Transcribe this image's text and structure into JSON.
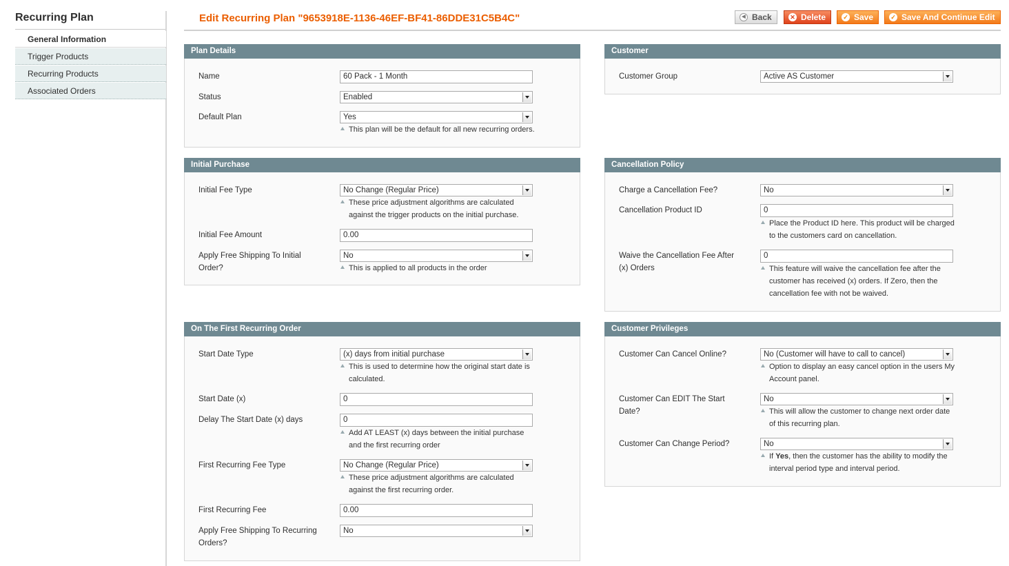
{
  "sidebar": {
    "title": "Recurring Plan",
    "tabs": [
      "General Information",
      "Trigger Products",
      "Recurring Products",
      "Associated Orders"
    ]
  },
  "header": {
    "title": "Edit Recurring Plan \"9653918E-1136-46EF-BF41-86DDE31C5B4C\"",
    "buttons": {
      "back": "Back",
      "delete": "Delete",
      "save": "Save",
      "save_continue": "Save And Continue Edit"
    }
  },
  "plan_details": {
    "heading": "Plan Details",
    "name_label": "Name",
    "name_value": "60 Pack - 1 Month",
    "status_label": "Status",
    "status_value": "Enabled",
    "default_label": "Default Plan",
    "default_value": "Yes",
    "default_note": "This plan will be the default for all new recurring orders."
  },
  "customer": {
    "heading": "Customer",
    "group_label": "Customer Group",
    "group_value": "Active AS Customer"
  },
  "initial_purchase": {
    "heading": "Initial Purchase",
    "fee_type_label": "Initial Fee Type",
    "fee_type_value": "No Change (Regular Price)",
    "fee_type_note_1": "These price adjustment algorithms are calculated",
    "fee_type_note_2": "against the trigger products on the initial purchase.",
    "fee_amount_label": "Initial Fee Amount",
    "fee_amount_value": "0.00",
    "shipping_label_1": "Apply Free Shipping To Initial",
    "shipping_label_2": "Order?",
    "shipping_value": "No",
    "shipping_note": "This is applied to all products in the order"
  },
  "cancellation": {
    "heading": "Cancellation Policy",
    "charge_label": "Charge a Cancellation Fee?",
    "charge_value": "No",
    "product_label": "Cancellation Product ID",
    "product_value": "0",
    "product_note_1": "Place the Product ID here. This product will be charged",
    "product_note_2": "to the customers card on cancellation.",
    "waive_label_1": "Waive the Cancellation Fee After",
    "waive_label_2": "(x) Orders",
    "waive_value": "0",
    "waive_note_1": "This feature will waive the cancellation fee after the",
    "waive_note_2": "customer has received (x) orders. If Zero, then the",
    "waive_note_3": "cancellation fee with not be waived."
  },
  "first_recurring": {
    "heading": "On The First Recurring Order",
    "start_type_label": "Start Date Type",
    "start_type_value": "(x) days from initial purchase",
    "start_type_note_1": "This is used to determine how the original start date is",
    "start_type_note_2": "calculated.",
    "start_date_label": "Start Date (x)",
    "start_date_value": "0",
    "delay_label": "Delay The Start Date (x) days",
    "delay_value": "0",
    "delay_note_1": "Add AT LEAST (x) days between the initial purchase",
    "delay_note_2": "and the first recurring order",
    "fee_type_label": "First Recurring Fee Type",
    "fee_type_value": "No Change (Regular Price)",
    "fee_type_note_1": "These price adjustment algorithms are calculated",
    "fee_type_note_2": "against the first recurring order.",
    "fee_label": "First Recurring Fee",
    "fee_value": "0.00",
    "shipping_label_1": "Apply Free Shipping To Recurring",
    "shipping_label_2": "Orders?",
    "shipping_value": "No"
  },
  "privileges": {
    "heading": "Customer Privileges",
    "cancel_label": "Customer Can Cancel Online?",
    "cancel_value": "No (Customer will have to call to cancel)",
    "cancel_note_1": "Option to display an easy cancel option in the users My",
    "cancel_note_2": "Account panel.",
    "edit_label_1": "Customer Can EDIT The Start",
    "edit_label_2": "Date?",
    "edit_value": "No",
    "edit_note_1": "This will allow the customer to change next order date",
    "edit_note_2": "of this recurring plan.",
    "period_label": "Customer Can Change Period?",
    "period_value": "No",
    "period_note_if": "If",
    "period_note_yes": "Yes",
    "period_note_1": ", then the customer has the ability to modify the",
    "period_note_2": "interval period type and interval period."
  },
  "colors": {
    "accent": "#eb5e00",
    "section_header": "#6f8992",
    "tab_bg": "#e7efef"
  },
  "icons": {
    "back": "back-arrow-icon",
    "delete": "delete-x-icon",
    "save": "check-icon",
    "note": "note-triangle-icon",
    "select": "dropdown-arrow-icon"
  }
}
